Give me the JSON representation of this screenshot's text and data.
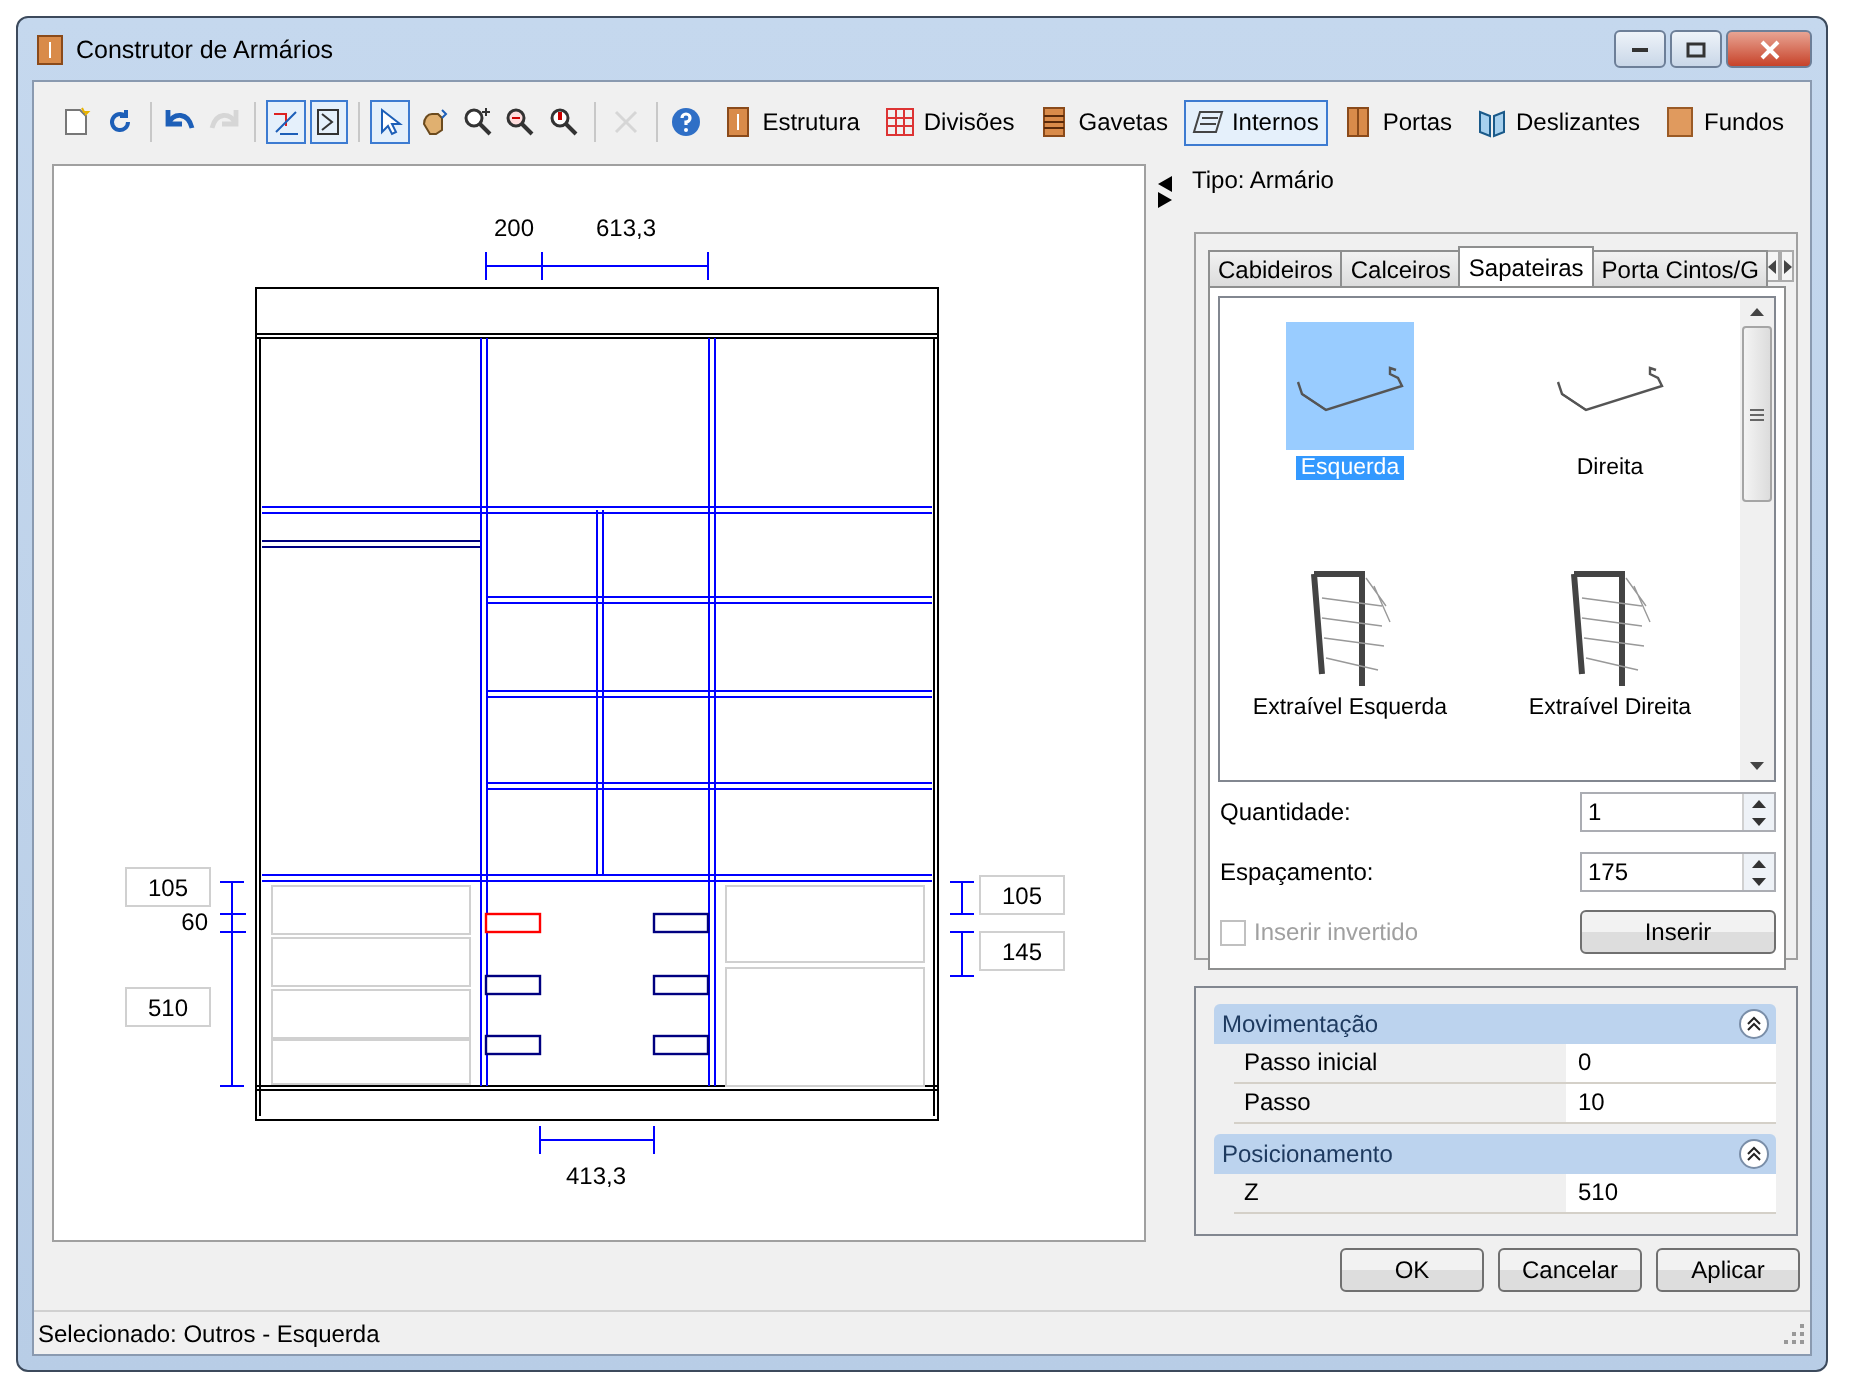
{
  "window": {
    "title": "Construtor de Armários"
  },
  "toolbar": {
    "tools": [
      {
        "selected": false,
        "disabled": false
      },
      {
        "selected": false,
        "disabled": false
      },
      {
        "selected": false,
        "disabled": false
      },
      {
        "selected": false,
        "disabled": true
      },
      {
        "selected": true,
        "disabled": false
      },
      {
        "selected": true,
        "disabled": false
      },
      {
        "selected": true,
        "disabled": false
      },
      {
        "selected": false,
        "disabled": false
      },
      {
        "selected": false,
        "disabled": false
      },
      {
        "selected": false,
        "disabled": false
      },
      {
        "selected": false,
        "disabled": false
      },
      {
        "selected": false,
        "disabled": true
      },
      {
        "selected": false,
        "disabled": false
      }
    ],
    "categories": [
      {
        "label": "Estrutura",
        "selected": false
      },
      {
        "label": "Divisões",
        "selected": false
      },
      {
        "label": "Gavetas",
        "selected": false
      },
      {
        "label": "Internos",
        "selected": true
      },
      {
        "label": "Portas",
        "selected": false
      },
      {
        "label": "Deslizantes",
        "selected": false
      },
      {
        "label": "Fundos",
        "selected": false
      }
    ]
  },
  "drawing": {
    "top_dimensions": [
      "200",
      "613,3"
    ],
    "bottom_dimension": "413,3",
    "left_fields": [
      "105",
      "510"
    ],
    "left_label": "60",
    "right_fields": [
      "105",
      "145"
    ],
    "shoe_racks": [
      {
        "selected": true
      },
      {
        "selected": false
      },
      {
        "selected": false
      },
      {
        "selected": false
      },
      {
        "selected": false
      },
      {
        "selected": false
      }
    ]
  },
  "type_label": "Tipo: Armário",
  "tabs": [
    {
      "label": "Cabideiros",
      "selected": false
    },
    {
      "label": "Calceiros",
      "selected": false
    },
    {
      "label": "Sapateiras",
      "selected": true
    },
    {
      "label": "Porta Cintos/G",
      "selected": false
    }
  ],
  "items": [
    {
      "label": "Esquerda",
      "kind": "shelf",
      "selected": true
    },
    {
      "label": "Direita",
      "kind": "shelf",
      "selected": false
    },
    {
      "label": "Extraível Esquerda",
      "kind": "pullout",
      "selected": false
    },
    {
      "label": "Extraível Direita",
      "kind": "pullout",
      "selected": false
    }
  ],
  "quantity": {
    "label": "Quantidade:",
    "value": "1"
  },
  "spacing": {
    "label": "Espaçamento:",
    "value": "175"
  },
  "invert": {
    "label": "Inserir invertido",
    "checked": false,
    "disabled": true
  },
  "insert_button": "Inserir",
  "properties": [
    {
      "title": "Movimentação",
      "expanded": true,
      "rows": [
        {
          "name": "Passo inicial",
          "value": "0"
        },
        {
          "name": "Passo",
          "value": "10"
        }
      ]
    },
    {
      "title": "Posicionamento",
      "expanded": true,
      "rows": [
        {
          "name": "Z",
          "value": "510"
        }
      ]
    }
  ],
  "buttons": [
    "OK",
    "Cancelar",
    "Aplicar"
  ],
  "status_bar": "Selecionado: Outros - Esquerda"
}
